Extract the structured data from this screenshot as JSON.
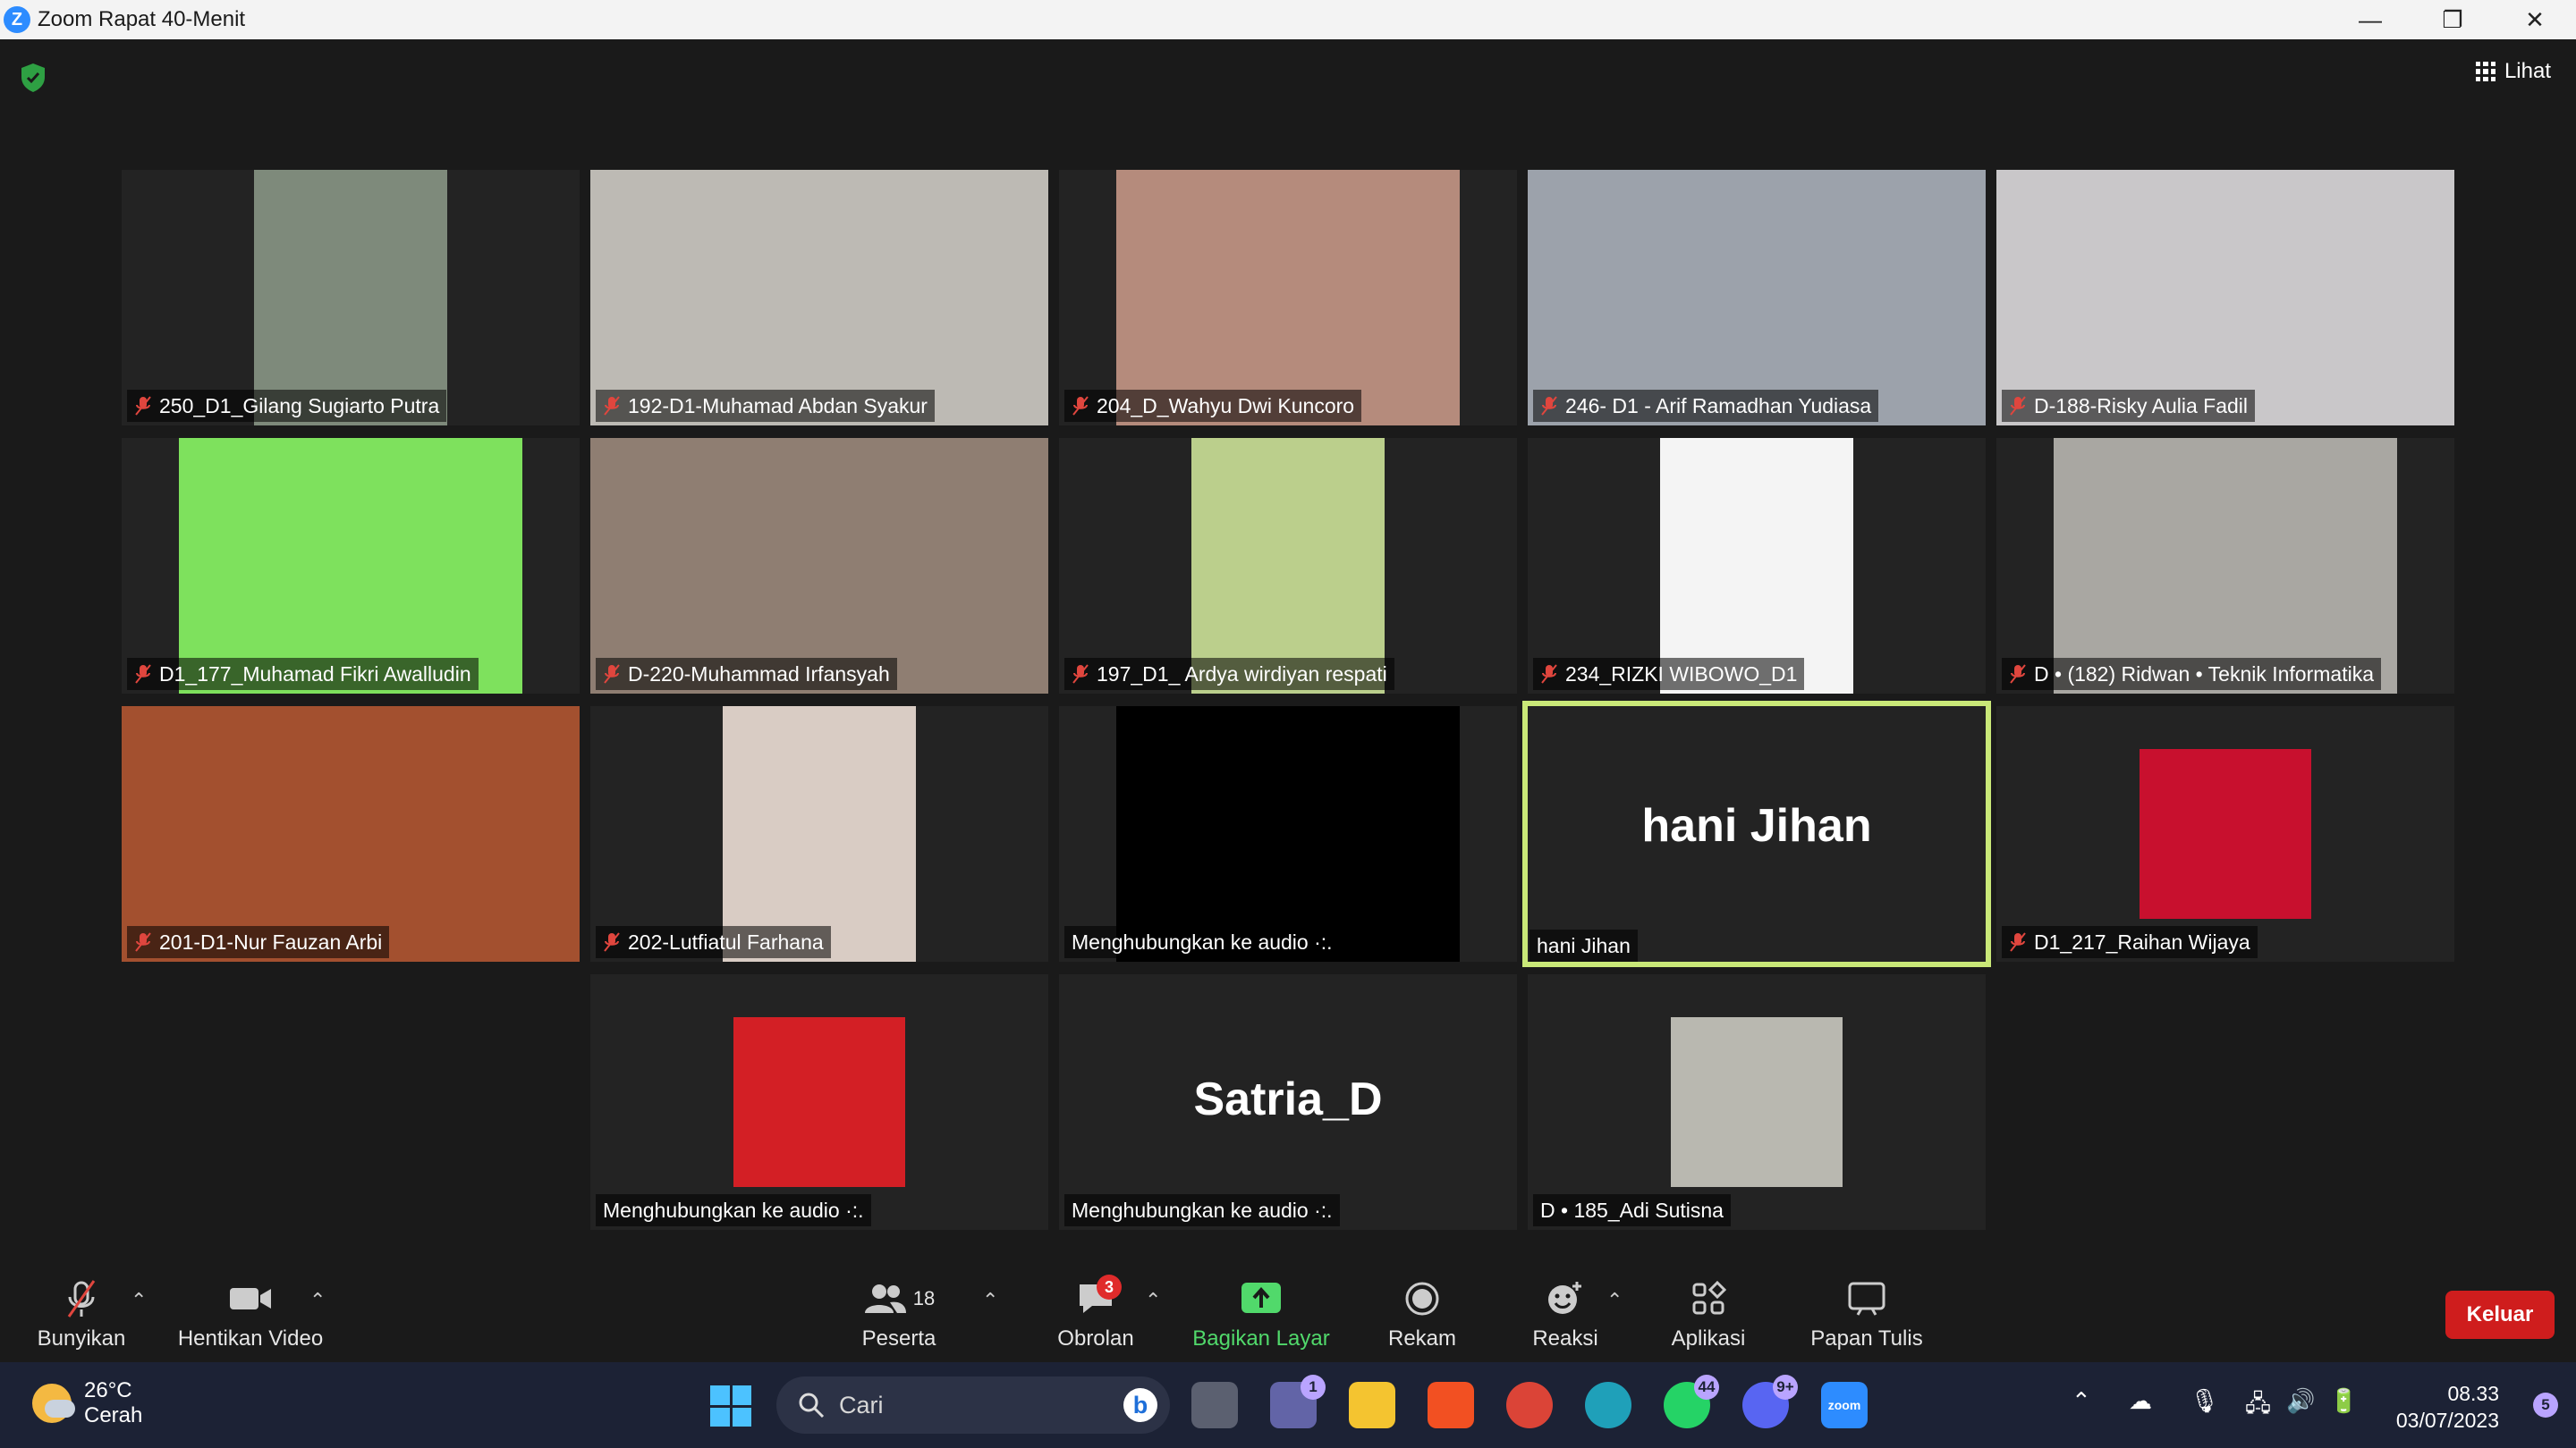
{
  "window": {
    "title": "Zoom Rapat 40-Menit",
    "minimize": "—",
    "restore": "❐",
    "close": "✕"
  },
  "header": {
    "view_label": "Lihat"
  },
  "tiles": [
    {
      "name": "250_D1_Gilang Sugiarto Putra",
      "muted": true,
      "video_bg": "#7e8a7b"
    },
    {
      "name": "192-D1-Muhamad Abdan Syakur",
      "muted": true,
      "video_bg": "#bdbab4"
    },
    {
      "name": "204_D_Wahyu Dwi Kuncoro",
      "muted": true,
      "video_bg": "#b58b7c"
    },
    {
      "name": "246- D1 - Arif Ramadhan Yudiasa",
      "muted": true,
      "video_bg": "#9ca2ab"
    },
    {
      "name": "D-188-Risky Aulia Fadil",
      "muted": true,
      "video_bg": "#c9c7c9"
    },
    {
      "name": "D1_177_Muhamad Fikri Awalludin",
      "muted": true,
      "video_bg": "#7ee15d"
    },
    {
      "name": "D-220-Muhammad Irfansyah",
      "muted": true,
      "video_bg": "#8f7e72"
    },
    {
      "name": "197_D1_ Ardya wirdiyan respati",
      "muted": true,
      "video_bg": "#bbcf8c"
    },
    {
      "name": "234_RIZKI WIBOWO_D1",
      "muted": true,
      "video_bg": "#f4f4f4"
    },
    {
      "name": "D • (182) Ridwan • Teknik Informatika",
      "muted": true,
      "video_bg": "#a9a7a2"
    },
    {
      "name": "201-D1-Nur Fauzan Arbi",
      "muted": true,
      "video_bg": "#a3502f"
    },
    {
      "name": "202-Lutfiatul Farhana",
      "muted": true,
      "video_bg": "#d9ccc4"
    },
    {
      "name": "Menghubungkan ke audio ·:.",
      "muted": false,
      "video_bg": "#000000"
    },
    {
      "name": "hani Jihan",
      "muted": false,
      "display_name": "hani Jihan"
    },
    {
      "name": "D1_217_Raihan Wijaya",
      "muted": true,
      "video_bg": "#c8102e"
    },
    {
      "name": "Menghubungkan ke audio ·:.",
      "muted": false,
      "video_bg": "#d31f25"
    },
    {
      "name": "Menghubungkan ke audio ·:.",
      "muted": false,
      "display_name": "Satria_D"
    },
    {
      "name": "D • 185_Adi Sutisna",
      "muted": false,
      "video_bg": "#b9b8b0"
    }
  ],
  "toolbar": {
    "unmute": "Bunyikan",
    "stop_video": "Hentikan Video",
    "participants": "Peserta",
    "participants_count": "18",
    "chat": "Obrolan",
    "chat_badge": "3",
    "share": "Bagikan Layar",
    "record": "Rekam",
    "reactions": "Reaksi",
    "apps": "Aplikasi",
    "whiteboard": "Papan Tulis",
    "leave": "Keluar",
    "share_color": "#51d96b",
    "leave_color": "#cf1d1d"
  },
  "taskbar": {
    "temp": "26°C",
    "weather": "Cerah",
    "search_placeholder": "Cari",
    "teams_badge": "1",
    "whatsapp_badge": "44",
    "discord_badge": "9+",
    "zoom_label": "zoom",
    "time": "08.33",
    "date": "03/07/2023",
    "notifications": "5"
  }
}
